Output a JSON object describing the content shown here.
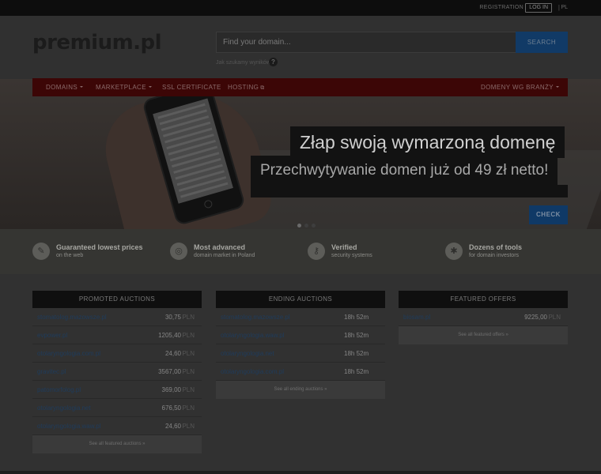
{
  "topbar": {
    "register": "REGISTRATION",
    "login": "LOG IN",
    "separator": "|",
    "lang": "PL"
  },
  "header": {
    "logo": "premium.pl",
    "search_placeholder": "Find your domain...",
    "search_button": "SEARCH",
    "hint": "Jak szukamy wyników?",
    "hint_icon": "?"
  },
  "nav": {
    "domains": "DOMAINS",
    "marketplace": "MARKETPLACE",
    "ssl": "SSL CERTIFICATE",
    "hosting": "HOSTING",
    "branches": "DOMENY WG BRANŻY"
  },
  "slide": {
    "title": "Złap swoją wymarzoną domenę",
    "subtitle": "Przechwytywanie domen już od 49 zł netto!",
    "check": "CHECK"
  },
  "features": [
    {
      "icon": "tag-icon",
      "glyph": "✎",
      "title": "Guaranteed lowest prices",
      "subtitle": "on the web"
    },
    {
      "icon": "globe-icon",
      "glyph": "◎",
      "title": "Most advanced",
      "subtitle": "domain market in Poland"
    },
    {
      "icon": "key-icon",
      "glyph": "⚷",
      "title": "Verified",
      "subtitle": "security systems"
    },
    {
      "icon": "tools-icon",
      "glyph": "✱",
      "title": "Dozens of tools",
      "subtitle": "for domain investors"
    }
  ],
  "promoted": {
    "title": "PROMOTED AUCTIONS",
    "currency": "PLN",
    "rows": [
      {
        "name": "stomatolog.mazowsze.pl",
        "price": "30,75"
      },
      {
        "name": "evpower.pl",
        "price": "1205,40"
      },
      {
        "name": "otolaryngologia.com.pl",
        "price": "24,60"
      },
      {
        "name": "gravitec.pl",
        "price": "3567,00"
      },
      {
        "name": "patomorfolog.pl",
        "price": "369,00"
      },
      {
        "name": "otolaryngologia.net",
        "price": "676,50"
      },
      {
        "name": "otolaryngologia.waw.pl",
        "price": "24,60"
      }
    ],
    "footer": "See all featured auctions »"
  },
  "ending": {
    "title": "ENDING AUCTIONS",
    "rows": [
      {
        "name": "stomatolog.mazowsze.pl",
        "time": "18h 52m"
      },
      {
        "name": "otolaryngologia.waw.pl",
        "time": "18h 52m"
      },
      {
        "name": "otolaryngologia.net",
        "time": "18h 52m"
      },
      {
        "name": "otolaryngologia.com.pl",
        "time": "18h 52m"
      }
    ],
    "footer": "See all ending auctions »"
  },
  "featured": {
    "title": "FEATURED OFFERS",
    "currency": "PLN",
    "rows": [
      {
        "name": "biosam.pl",
        "price": "9225,00"
      }
    ],
    "footer": "See all featured offers »"
  },
  "colors": {
    "accent": "#0f3966",
    "nav": "#3c0606",
    "link": "#1f3c5c"
  }
}
